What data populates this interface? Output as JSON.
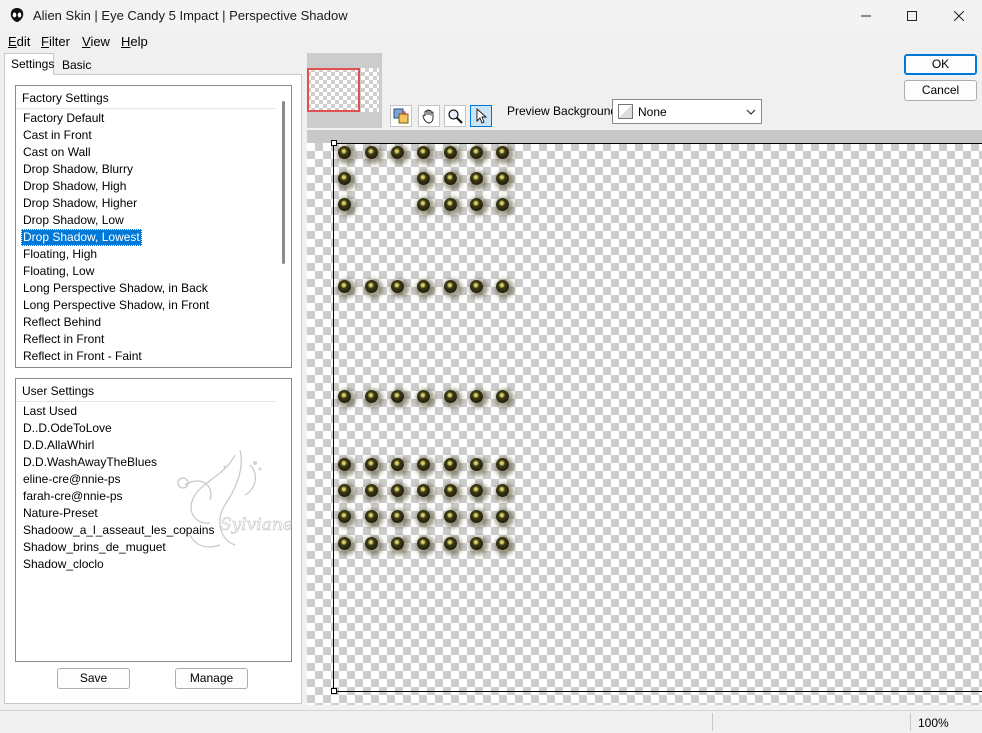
{
  "window": {
    "title": "Alien Skin | Eye Candy 5 Impact | Perspective Shadow"
  },
  "menu": [
    {
      "label_first": "E",
      "label_rest": "dit"
    },
    {
      "label_first": "F",
      "label_rest": "ilter"
    },
    {
      "label_first": "V",
      "label_rest": "iew"
    },
    {
      "label_first": "H",
      "label_rest": "elp"
    }
  ],
  "tabs": {
    "settings": "Settings",
    "basic": "Basic"
  },
  "factory_settings": {
    "header": "Factory Settings",
    "items": [
      "Factory Default",
      "Cast in Front",
      "Cast on Wall",
      "Drop Shadow, Blurry",
      "Drop Shadow, High",
      "Drop Shadow, Higher",
      "Drop Shadow, Low",
      "Drop Shadow, Lowest",
      "Floating, High",
      "Floating, Low",
      "Long Perspective Shadow, in Back",
      "Long Perspective Shadow, in Front",
      "Reflect Behind",
      "Reflect in Front",
      "Reflect in Front - Faint"
    ],
    "selected_index": 7
  },
  "user_settings": {
    "header": "User Settings",
    "items": [
      "Last Used",
      "D..D.OdeToLove",
      "D.D.AllaWhirl",
      "D.D.WashAwayTheBlues",
      "eline-cre@nnie-ps",
      "farah-cre@nnie-ps",
      "Nature-Preset",
      "Shadoow_a_l_asseaut_les_copains",
      "Shadow_brins_de_muguet",
      "Shadow_cloclo"
    ]
  },
  "buttons": {
    "save": "Save",
    "manage": "Manage",
    "ok": "OK",
    "cancel": "Cancel"
  },
  "preview_background": {
    "label": "Preview Background:",
    "value": "None"
  },
  "status": {
    "zoom": "100%"
  },
  "watermark_text": "Sylviane",
  "colors": {
    "accent": "#0078d7",
    "selection": "#0078d7",
    "nav_rect": "#e05050"
  }
}
